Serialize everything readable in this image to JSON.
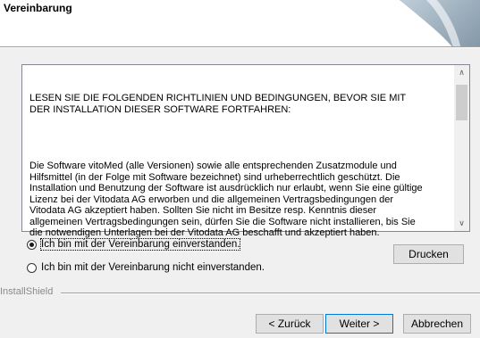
{
  "header": {
    "title": "Vereinbarung"
  },
  "license": {
    "heading": "LESEN SIE DIE FOLGENDEN RICHTLINIEN UND BEDINGUNGEN, BEVOR SIE MIT\nDER INSTALLATION DIESER SOFTWARE FORTFAHREN:",
    "body": "Die Software vitoMed (alle Versionen) sowie alle entsprechenden Zusatzmodule und\nHilfsmittel (in der Folge mit Software bezeichnet) sind urheberrechtlich geschützt. Die\nInstallation und Benutzung der Software ist ausdrücklich nur erlaubt, wenn Sie eine gültige\nLizenz bei der Vitodata AG erworben und die allgemeinen Vertragsbedingungen der\nVitodata AG akzeptiert haben. Sollten Sie nicht im Besitze resp. Kenntnis dieser\nallgemeinen Vertragsbedingungen sein, dürfen Sie die Software nicht installieren, bis Sie\ndie notwendigen Unterlagen bei der Vitodata AG beschafft und akzeptiert haben."
  },
  "options": {
    "accept_label": "Ich bin mit der Vereinbarung einverstanden.",
    "decline_label": "Ich bin mit der Vereinbarung nicht einverstanden.",
    "selected": "accept"
  },
  "buttons": {
    "print": "Drucken",
    "back": "< Zurück",
    "next": "Weiter >",
    "cancel": "Abbrechen"
  },
  "footer": {
    "brand": "InstallShield"
  }
}
